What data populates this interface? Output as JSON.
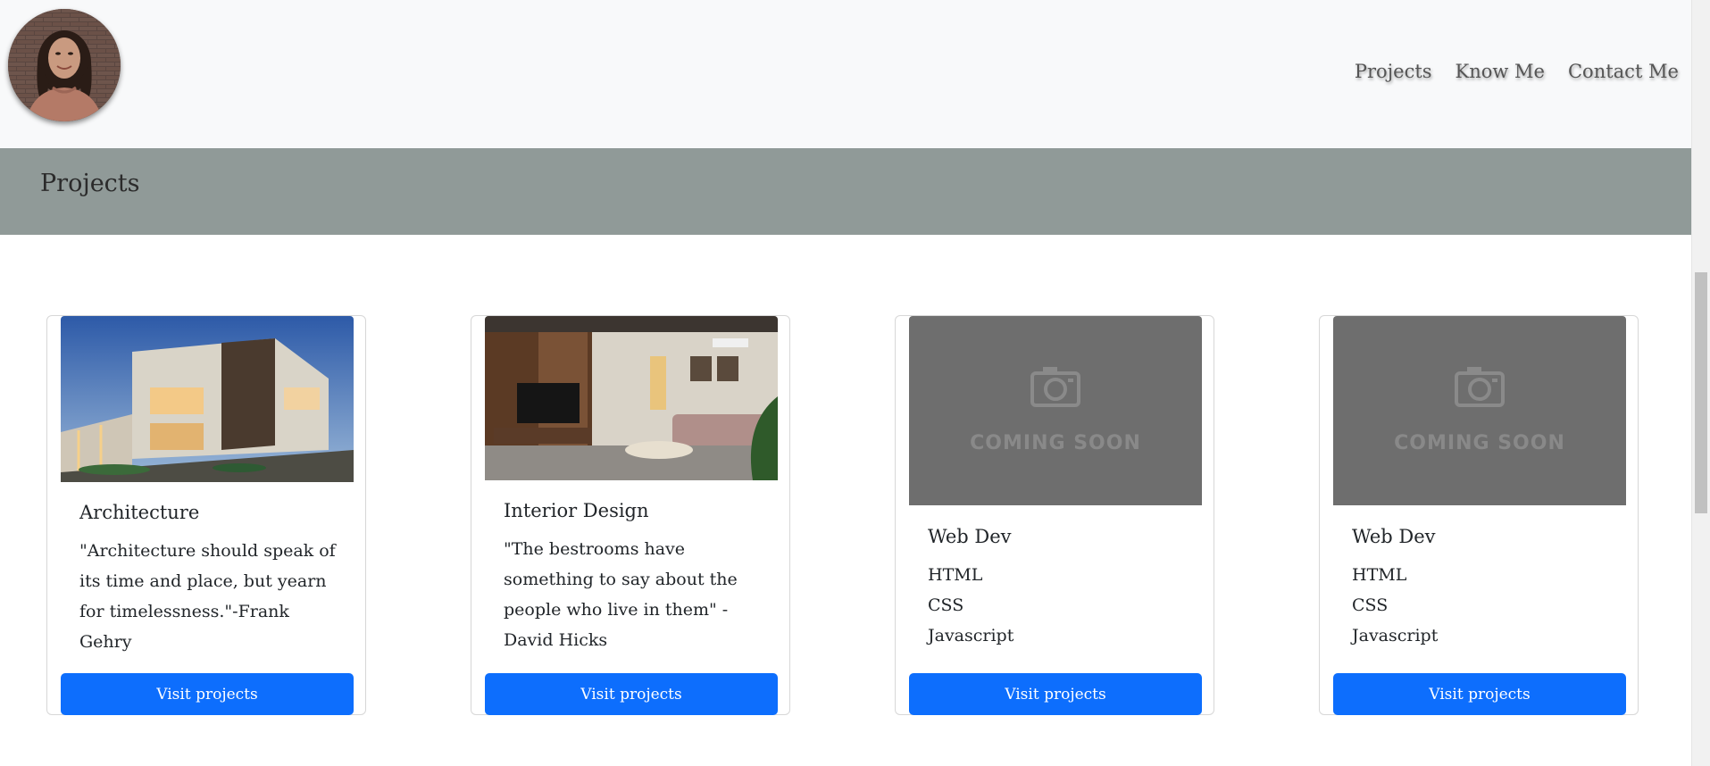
{
  "nav": {
    "links": [
      "Projects",
      "Know Me",
      "Contact Me"
    ]
  },
  "section": {
    "title": "Projects"
  },
  "cards": [
    {
      "image": "architecture-photo",
      "title": "Architecture",
      "text": "\"Architecture should speak of its time and place, but yearn for timelessness.\"-Frank Gehry",
      "button": "Visit projects"
    },
    {
      "image": "interior-photo",
      "title": "Interior Design",
      "text": "\"The bestrooms have something to say about the people who live in them\" - David Hicks",
      "button": "Visit projects"
    },
    {
      "image": "coming-soon",
      "image_text": "COMING SOON",
      "title": "Web Dev",
      "items": [
        "HTML",
        "CSS",
        "Javascript"
      ],
      "button": "Visit projects"
    },
    {
      "image": "coming-soon",
      "image_text": "COMING SOON",
      "title": "Web Dev",
      "items": [
        "HTML",
        "CSS",
        "Javascript"
      ],
      "button": "Visit projects"
    }
  ],
  "colors": {
    "navbar_bg": "#f8f9fa",
    "banner_bg": "#909a98",
    "button_bg": "#0d6efd",
    "coming_soon_bg": "#6e6e6e"
  }
}
